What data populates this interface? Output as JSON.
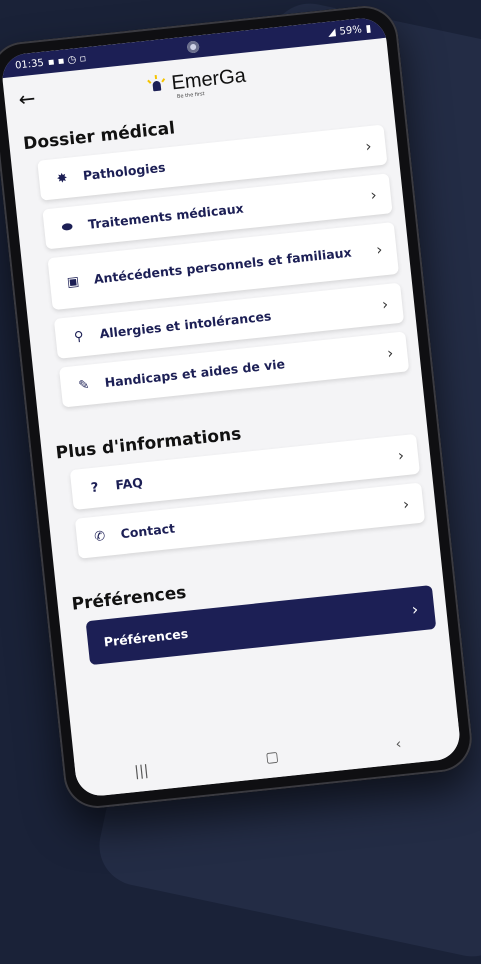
{
  "statusbar": {
    "time": "01:35",
    "battery": "59%"
  },
  "app": {
    "name": "EmerGa",
    "tagline": "Be the first"
  },
  "sections": {
    "medical": {
      "title": "Dossier médical",
      "items": [
        {
          "label": "Pathologies",
          "icon": "virus-icon"
        },
        {
          "label": "Traitements médicaux",
          "icon": "pills-icon"
        },
        {
          "label": "Antécédents personnels et familiaux",
          "icon": "clipboard-icon"
        },
        {
          "label": "Allergies et intolérances",
          "icon": "allergy-icon"
        },
        {
          "label": "Handicaps et aides de vie",
          "icon": "accessibility-icon"
        }
      ]
    },
    "info": {
      "title": "Plus d'informations",
      "items": [
        {
          "label": "FAQ",
          "icon": "question-icon"
        },
        {
          "label": "Contact",
          "icon": "phone-icon"
        }
      ]
    },
    "prefs": {
      "title": "Préférences",
      "button_label": "Préférences"
    }
  },
  "colors": {
    "primary": "#1c1f55",
    "background": "#1a2238",
    "accent": "#f5c400"
  }
}
